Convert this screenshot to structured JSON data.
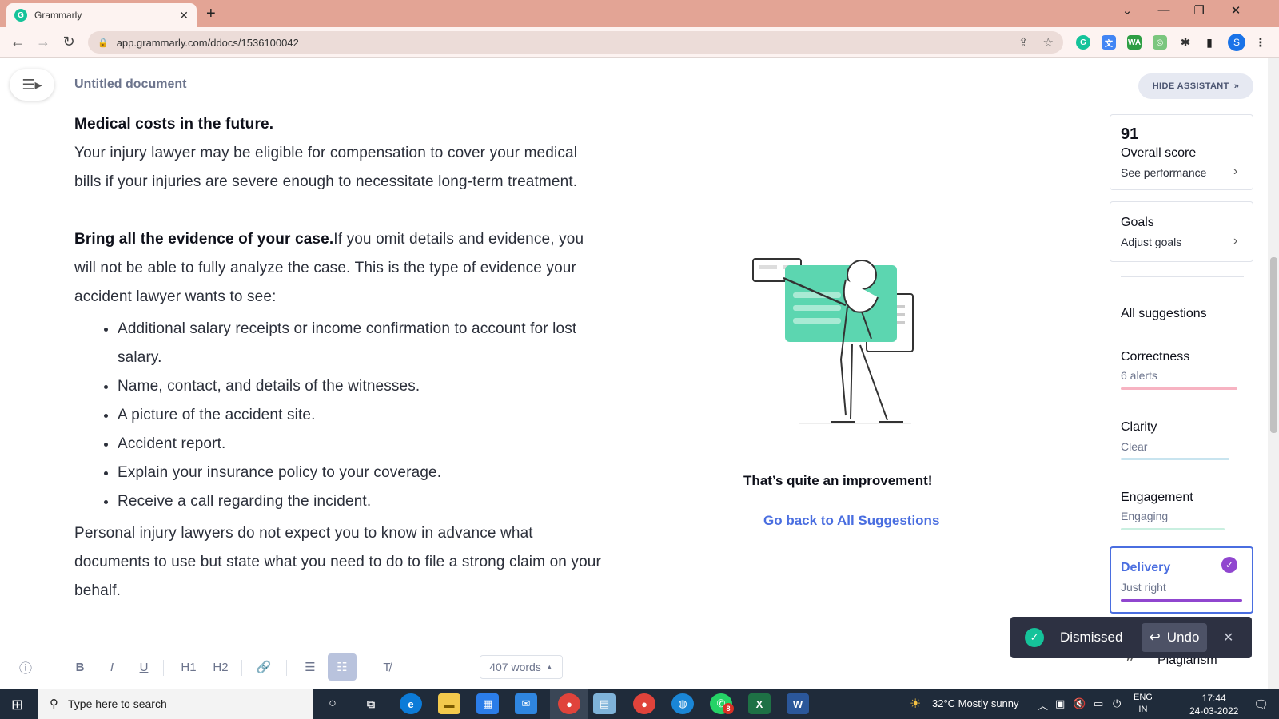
{
  "browser": {
    "tab_title": "Grammarly",
    "url": "app.grammarly.com/ddocs/1536100042",
    "new_tab": "+",
    "profile_initial": "S"
  },
  "editor": {
    "doc_title": "Untitled document",
    "heading1": "Medical costs in the future.",
    "para1": "Your injury lawyer may be eligible for compensation to cover your medical bills if your injuries are severe enough to necessitate long-term treatment.",
    "heading2": "Bring all the evidence of your case.",
    "para2": "If you omit details and evidence, you will not be able to fully analyze the case. This is the type of evidence your accident lawyer wants to see:",
    "bullets": [
      "Additional salary receipts or income confirmation to account for lost salary.",
      "Name, contact, and details of the witnesses.",
      "A picture of the accident site.",
      "Accident report.",
      "Explain your insurance policy to your coverage.",
      "Receive a call regarding the incident."
    ],
    "para3": "Personal injury lawyers do not expect you to know in advance what documents to use but state what you need to do to file a strong claim on your behalf.",
    "improvement_text": "That’s quite an improvement!",
    "go_back_link": "Go back to All Suggestions",
    "toolbar": {
      "bold": "B",
      "italic": "I",
      "underline": "U",
      "h1": "H1",
      "h2": "H2",
      "word_count": "407 words"
    }
  },
  "assistant": {
    "hide_button": "HIDE ASSISTANT",
    "score": "91",
    "score_label": "Overall score",
    "see_performance": "See performance",
    "goals_title": "Goals",
    "adjust_goals": "Adjust goals",
    "all_suggestions": "All suggestions",
    "categories": [
      {
        "name": "Correctness",
        "status": "6 alerts",
        "color": "#f7b3c2"
      },
      {
        "name": "Clarity",
        "status": "Clear",
        "color": "#c8e4ef"
      },
      {
        "name": "Engagement",
        "status": "Engaging",
        "color": "#c9efe0"
      },
      {
        "name": "Delivery",
        "status": "Just right",
        "color": "#9046cf"
      }
    ],
    "plagiarism": "Plagiarism",
    "accent_color": "#4a6ee0"
  },
  "toast": {
    "message": "Dismissed",
    "undo": "Undo"
  },
  "taskbar": {
    "search_placeholder": "Type here to search",
    "weather": "32°C  Mostly sunny",
    "lang_top": "ENG",
    "lang_bottom": "IN",
    "time": "17:44",
    "date": "24-03-2022",
    "whatsapp_badge": "8"
  }
}
